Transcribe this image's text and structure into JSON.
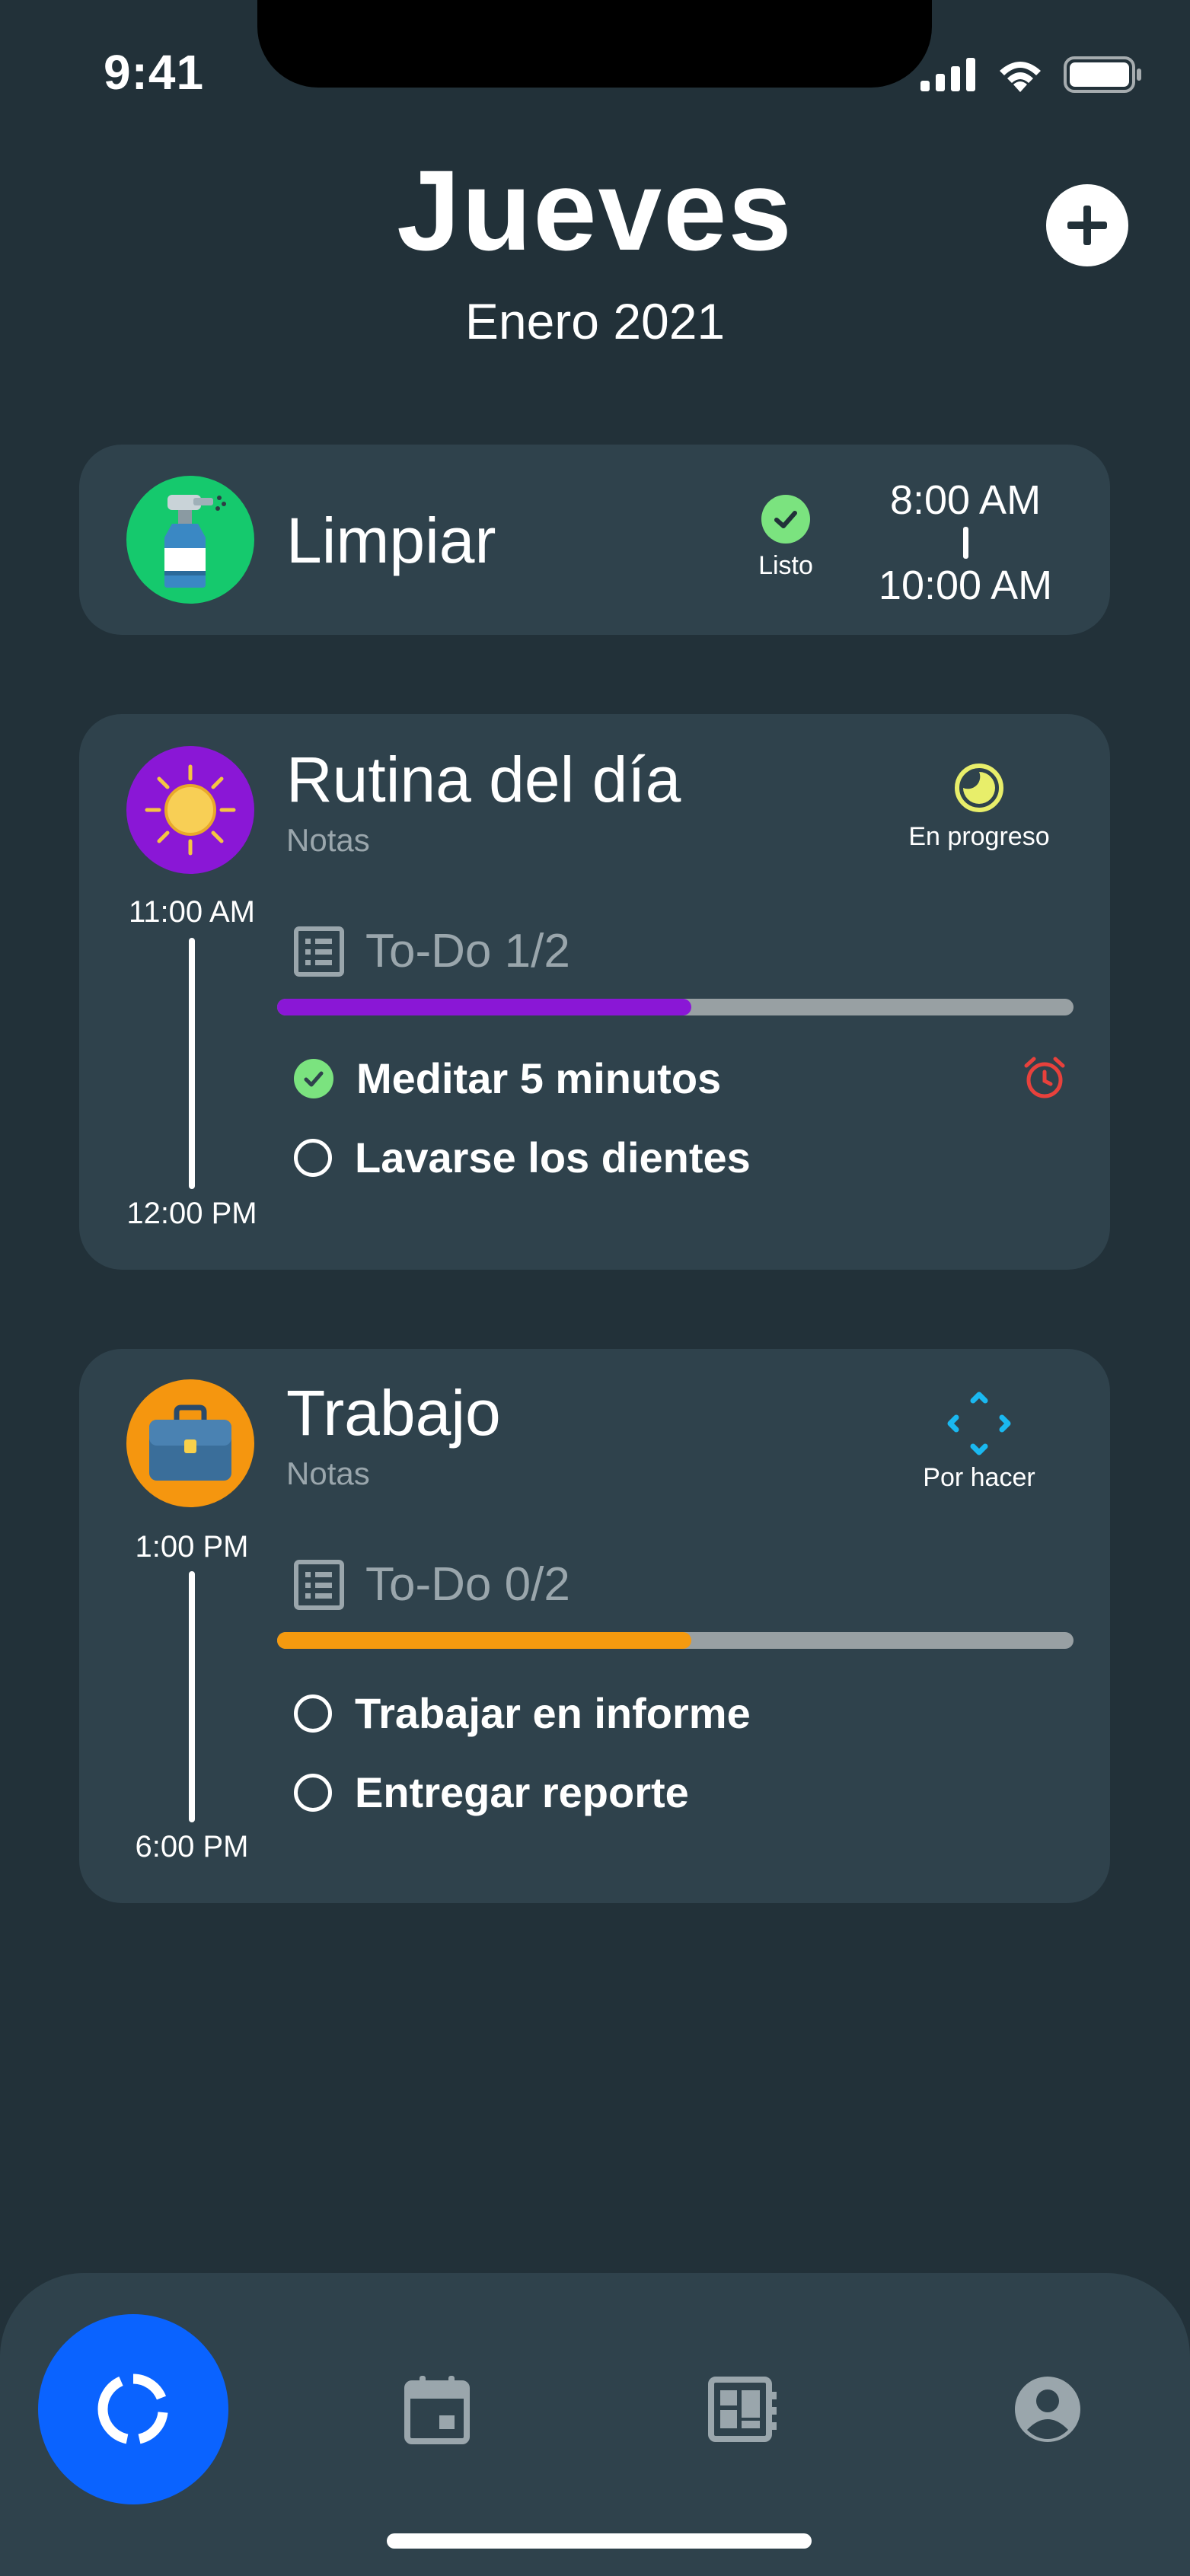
{
  "status_bar": {
    "time": "9:41"
  },
  "header": {
    "day": "Jueves",
    "month_year": "Enero 2021"
  },
  "cards": [
    {
      "title": "Limpiar",
      "status": "Listo",
      "start": "8:00 AM",
      "end": "10:00 AM",
      "avatar_color": "#15c96d",
      "icon": "spray-bottle-icon"
    },
    {
      "title": "Rutina del día",
      "notes": "Notas",
      "status": "En progreso",
      "start": "11:00 AM",
      "end": "12:00 PM",
      "avatar_color": "#8a17d6",
      "icon": "sun-icon",
      "todo": {
        "label": "To-Do 1/2",
        "progress": 0.52,
        "color": "#8a17d6"
      },
      "tasks": [
        {
          "label": "Meditar 5 minutos",
          "done": true,
          "alarm": true
        },
        {
          "label": "Lavarse los dientes",
          "done": false
        }
      ]
    },
    {
      "title": "Trabajo",
      "notes": "Notas",
      "status": "Por hacer",
      "start": "1:00 PM",
      "end": "6:00 PM",
      "avatar_color": "#f5960f",
      "icon": "briefcase-icon",
      "todo": {
        "label": "To-Do 0/2",
        "progress": 0.52,
        "color": "#f59a0f"
      },
      "tasks": [
        {
          "label": "Trabajar en informe",
          "done": false
        },
        {
          "label": "Entregar reporte",
          "done": false
        }
      ]
    }
  ],
  "colors": {
    "background": "#223139",
    "card": "#2f424c",
    "done_green": "#7be37f",
    "progress_yellow": "#e8ee6a",
    "todo_blue": "#1ab8f0",
    "alarm_red": "#e8413c",
    "nav_active": "#0a63ff"
  },
  "nav": [
    {
      "name": "home",
      "icon": "progress-ring-icon",
      "active": true
    },
    {
      "name": "calendar",
      "icon": "calendar-icon"
    },
    {
      "name": "board",
      "icon": "dashboard-icon"
    },
    {
      "name": "profile",
      "icon": "account-icon"
    }
  ]
}
